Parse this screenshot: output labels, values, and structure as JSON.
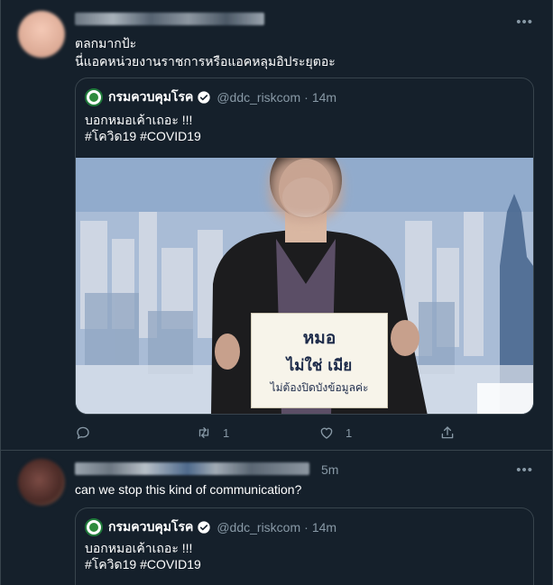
{
  "tweet1": {
    "text_line1": "ตลกมากป้ะ",
    "text_line2": "นี่แอคหน่วยงานราชการหรือแอคหลุมอิประยุตอะ",
    "quote": {
      "name": "กรมควบคุมโรค",
      "handle": "@ddc_riskcom",
      "separator": "·",
      "time": "14m",
      "text_line1": "บอกหมอเค้าเถอะ !!!",
      "text_line2": "#โควิด19 #COVID19",
      "sign": {
        "line1": "หมอ",
        "line2": "ไม่ใช่ เมีย",
        "line3": "ไม่ต้องปิดบังข้อมูลค่ะ"
      }
    },
    "actions": {
      "reply_count": "",
      "retweet_count": "1",
      "like_count": "1"
    }
  },
  "tweet2": {
    "time": "5m",
    "text": "can we stop this kind of communication?",
    "quote": {
      "name": "กรมควบคุมโรค",
      "handle": "@ddc_riskcom",
      "separator": "·",
      "time": "14m",
      "text_line1": "บอกหมอเค้าเถอะ !!!",
      "text_line2": "#โควิด19 #COVID19"
    }
  },
  "icons": {
    "more": "more-horizontal-icon",
    "reply": "reply-icon",
    "retweet": "retweet-icon",
    "like": "heart-icon",
    "share": "share-icon",
    "verified": "verified-badge-icon"
  },
  "colors": {
    "background": "#15202b",
    "border": "#38444d",
    "secondary_text": "#8899a6",
    "verified": "#1da1f2"
  }
}
